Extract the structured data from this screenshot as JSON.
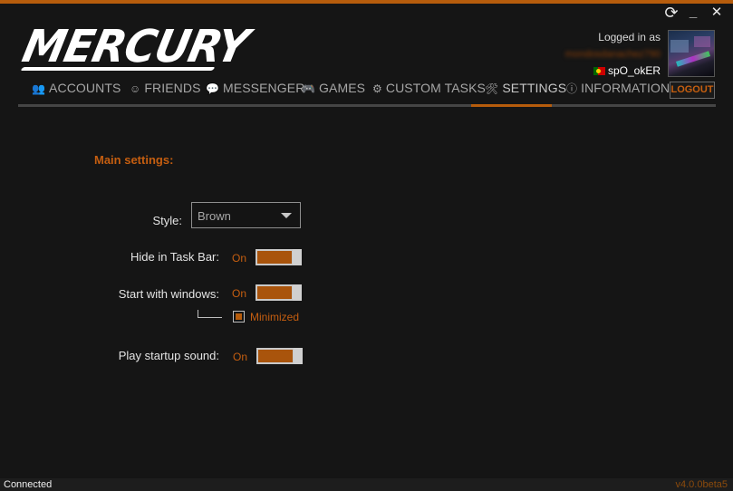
{
  "app": {
    "logo_text": "MERCURY"
  },
  "window_controls": {
    "refresh_icon": "refresh-icon",
    "minimize_label": "_",
    "close_label": "✕"
  },
  "user": {
    "logged_label": "Logged in as",
    "email": "mondosdanachez790",
    "username": "spO_okER",
    "flag_icon": "portugal-flag-icon"
  },
  "nav": {
    "tabs": [
      {
        "label": "ACCOUNTS",
        "icon": "users-icon",
        "glyph": "👥"
      },
      {
        "label": "FRIENDS",
        "icon": "smiley-icon",
        "glyph": "☺"
      },
      {
        "label": "MESSENGER",
        "icon": "chat-bubble-icon",
        "glyph": "💬"
      },
      {
        "label": "GAMES",
        "icon": "gamepad-icon",
        "glyph": "🎮"
      },
      {
        "label": "CUSTOM TASKS",
        "icon": "gear-icon",
        "glyph": "⚙"
      },
      {
        "label": "SETTINGS",
        "icon": "tools-icon",
        "glyph": "🛠"
      },
      {
        "label": "INFORMATION",
        "icon": "info-icon",
        "glyph": "ⓘ"
      }
    ],
    "active_tab": "SETTINGS",
    "logout_label": "LOGOUT"
  },
  "settings": {
    "section_title": "Main settings:",
    "style_label": "Style:",
    "style_value": "Brown",
    "hide_taskbar_label": "Hide in Task Bar:",
    "hide_taskbar_state": "On",
    "start_windows_label": "Start with windows:",
    "start_windows_state": "On",
    "minimized_label": "Minimized",
    "minimized_checked": true,
    "startup_sound_label": "Play startup sound:",
    "startup_sound_state": "On"
  },
  "status": {
    "text": "Connected",
    "version": "v4.0.0beta5"
  },
  "colors": {
    "accent": "#b65c0c",
    "accent_text": "#c55e10",
    "background": "#151515",
    "nav_rule": "#454545"
  }
}
